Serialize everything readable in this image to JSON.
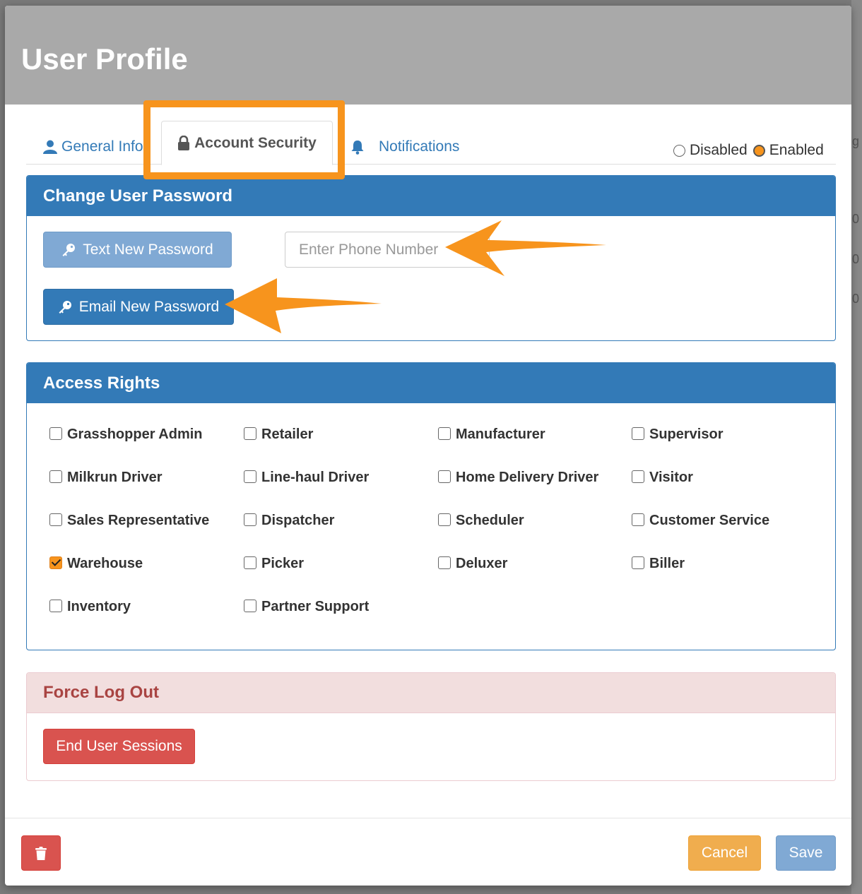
{
  "modal": {
    "title": "User Profile"
  },
  "tabs": {
    "general": {
      "label": "General Info",
      "icon": "user-icon"
    },
    "security": {
      "label": "Account Security",
      "icon": "lock-icon"
    },
    "notifications": {
      "label": "Notifications",
      "icon": "bell-icon"
    }
  },
  "status": {
    "options": [
      {
        "label": "Disabled",
        "selected": false
      },
      {
        "label": "Enabled",
        "selected": true
      }
    ]
  },
  "password_panel": {
    "title": "Change User Password",
    "text_button": "Text New Password",
    "email_button": "Email New Password",
    "phone_placeholder": "Enter Phone Number"
  },
  "rights_panel": {
    "title": "Access Rights",
    "items": [
      {
        "label": "Grasshopper Admin",
        "checked": false
      },
      {
        "label": "Retailer",
        "checked": false
      },
      {
        "label": "Manufacturer",
        "checked": false
      },
      {
        "label": "Supervisor",
        "checked": false
      },
      {
        "label": "Milkrun Driver",
        "checked": false
      },
      {
        "label": "Line-haul Driver",
        "checked": false
      },
      {
        "label": "Home Delivery Driver",
        "checked": false
      },
      {
        "label": "Visitor",
        "checked": false
      },
      {
        "label": "Sales Representative",
        "checked": false
      },
      {
        "label": "Dispatcher",
        "checked": false
      },
      {
        "label": "Scheduler",
        "checked": false
      },
      {
        "label": "Customer Service",
        "checked": false
      },
      {
        "label": "Warehouse",
        "checked": true
      },
      {
        "label": "Picker",
        "checked": false
      },
      {
        "label": "Deluxer",
        "checked": false
      },
      {
        "label": "Biller",
        "checked": false
      },
      {
        "label": "Inventory",
        "checked": false
      },
      {
        "label": "Partner Support",
        "checked": false
      }
    ]
  },
  "logout_panel": {
    "title": "Force Log Out",
    "button": "End User Sessions"
  },
  "footer": {
    "delete_icon": "trash-icon",
    "cancel": "Cancel",
    "save": "Save"
  },
  "colors": {
    "primary": "#337ab7",
    "danger": "#d9534f",
    "warning": "#f0ad4e",
    "highlight": "#f7941d"
  }
}
